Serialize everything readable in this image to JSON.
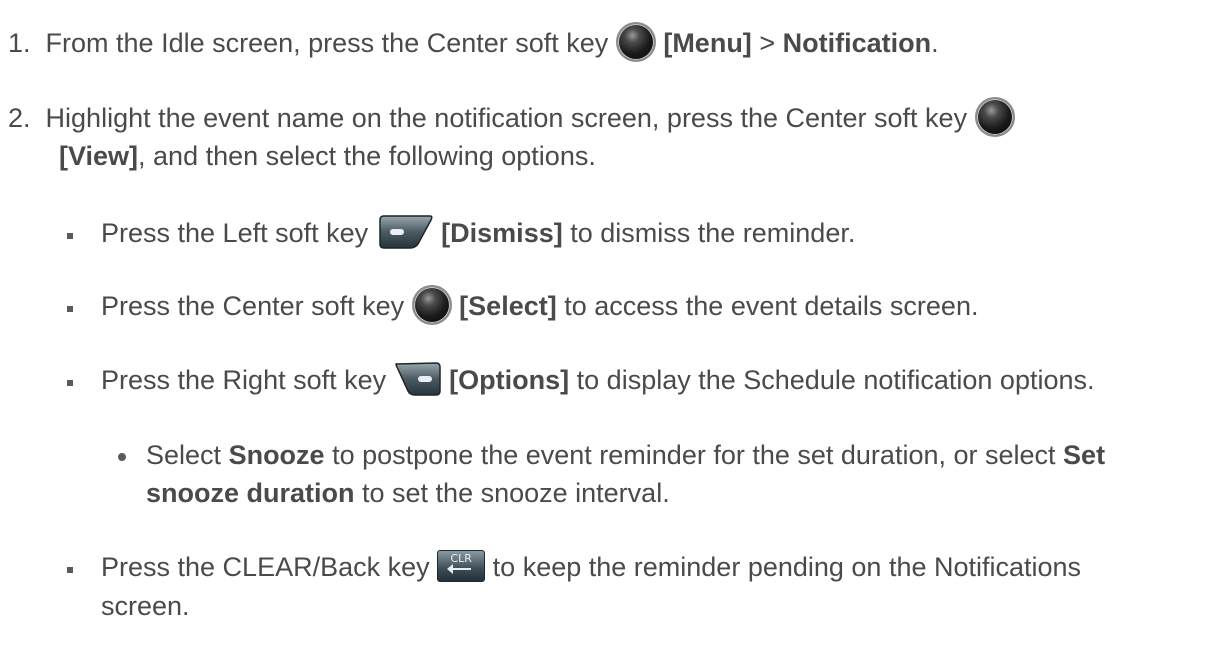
{
  "step1": {
    "num": "1.",
    "pre": "From the Idle screen, press the Center soft key",
    "key": "[Menu]",
    "sep": " > ",
    "dest": "Notification",
    "end": "."
  },
  "step2": {
    "num": "2.",
    "line1": "Highlight the event name on the notification screen, press the Center soft key",
    "key": "[View]",
    "line2": ", and then select the following options."
  },
  "bullets": {
    "dismiss": {
      "pre": "Press the Left soft key",
      "key": "[Dismiss]",
      "post": "to dismiss the reminder."
    },
    "select": {
      "pre": "Press the Center soft key",
      "key": "[Select]",
      "post": "to access the event details screen."
    },
    "options": {
      "pre": "Press the Right soft key",
      "key": "[Options]",
      "post": "to display the Schedule notification options."
    },
    "snooze": {
      "pre": "Select",
      "snooze": "Snooze",
      "mid": "to postpone the event reminder for the set duration, or select",
      "set": "Set",
      "duration": "snooze duration",
      "post": "to set the snooze interval."
    },
    "clear": {
      "pre": "Press the CLEAR/Back key",
      "post": "to keep the reminder pending on the Notifications",
      "post2": "screen.",
      "key_label": "CLR"
    }
  },
  "icons": {
    "center_key": "center-soft-key-icon",
    "left_key": "left-soft-key-icon",
    "right_key": "right-soft-key-icon",
    "clear_key": "clear-back-key-icon"
  }
}
